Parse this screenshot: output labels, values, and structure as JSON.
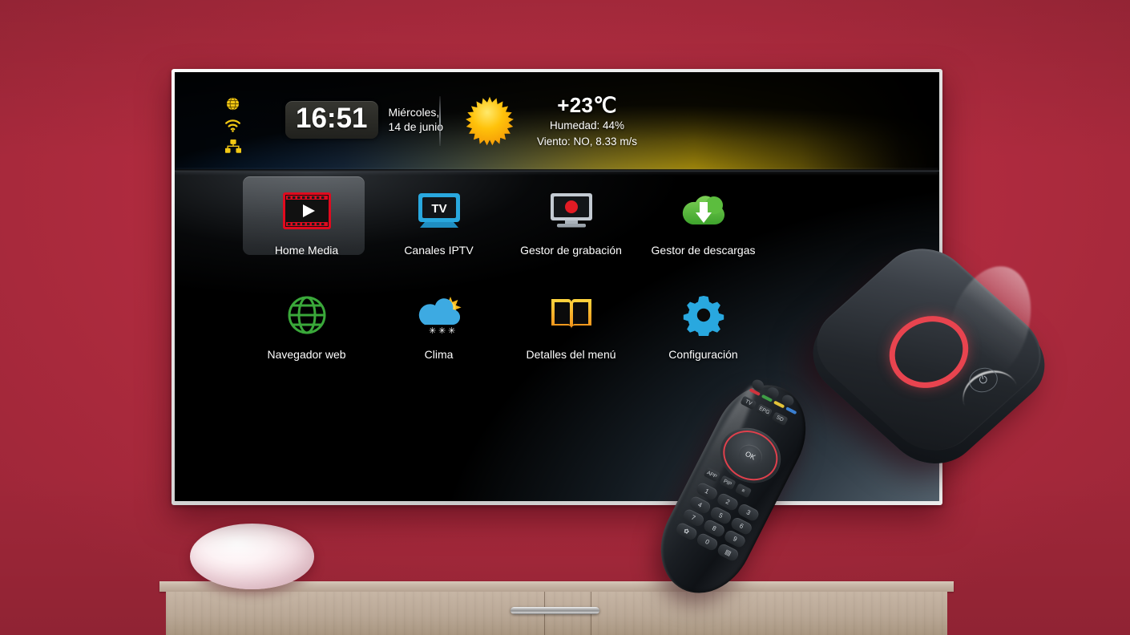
{
  "scene": {
    "wall_color": "#b32c40",
    "console_color": "#b9a795",
    "lamp_color": "#fdf3f5"
  },
  "tv": {
    "bezel_color": "#e3e3e3",
    "screen": {
      "statusbar": {
        "system_icons": [
          {
            "name": "globe-icon",
            "label": "Internet",
            "color": "#f2c814"
          },
          {
            "name": "wifi-icon",
            "label": "Wi-Fi",
            "color": "#f2c814"
          },
          {
            "name": "lan-icon",
            "label": "Ethernet",
            "color": "#f2c814"
          }
        ],
        "clock": {
          "time": "16:51",
          "weekday": "Miércoles,",
          "date": "14 de junio"
        },
        "weather": {
          "icon": "sun-icon",
          "temperature": "+23℃",
          "humidity": "Humedad: 44%",
          "wind": "Viento: NO, 8.33 m/s",
          "sun_color": "#ffc20a"
        }
      },
      "menu": {
        "rows": [
          [
            {
              "label": "Home Media",
              "icon": "film-strip-play-icon",
              "selected": true,
              "color": "#e00a1e"
            },
            {
              "label": "Canales IPTV",
              "icon": "tv-icon",
              "selected": false,
              "color": "#29a8df"
            },
            {
              "label": "Gestor de grabación",
              "icon": "record-tv-icon",
              "selected": false,
              "color": "#e21b24"
            },
            {
              "label": "Gestor de descargas",
              "icon": "cloud-download-icon",
              "selected": false,
              "color": "#49b737"
            }
          ],
          [
            {
              "label": "Navegador web",
              "icon": "globe-browser-icon",
              "selected": false,
              "color": "#3aa83a"
            },
            {
              "label": "Clima",
              "icon": "cloud-sun-snow-icon",
              "selected": false,
              "color": "#3aa5e0"
            },
            {
              "label": "Detalles del menú",
              "icon": "open-book-icon",
              "selected": false,
              "color": "#f5a623"
            },
            {
              "label": "Configuración",
              "icon": "gear-icon",
              "selected": false,
              "color": "#29a8df"
            }
          ]
        ]
      }
    }
  },
  "devices": {
    "set_top_box": {
      "name": "set-top-box",
      "ring_color": "#e8444f",
      "power_symbol": "⏻"
    },
    "remote": {
      "name": "remote-control",
      "ok_label": "OK",
      "ring_color": "#e0404c",
      "color_buttons": [
        "#d0333d",
        "#3f9e46",
        "#e3c339",
        "#3a7fd0"
      ],
      "function_labels": [
        "TV",
        "EPG",
        "SD"
      ],
      "mid_labels": [
        "APP",
        "PIP",
        "≡"
      ],
      "keypad": [
        "1",
        "2",
        "3",
        "4",
        "5",
        "6",
        "7",
        "8",
        "9",
        "✿",
        "0",
        "▤"
      ]
    }
  }
}
